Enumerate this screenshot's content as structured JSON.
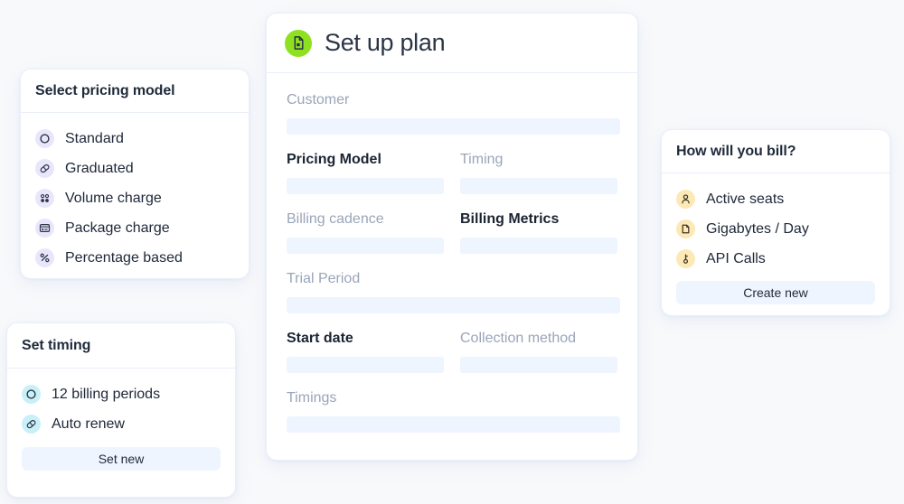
{
  "page": {
    "background_color": "#F8F9FB"
  },
  "pricing_card": {
    "title": "Select pricing model",
    "badge_color": "#E9E6FB",
    "options": [
      {
        "label": "Standard",
        "icon": "circle-outline-icon"
      },
      {
        "label": "Graduated",
        "icon": "pill-tilted-icon"
      },
      {
        "label": "Volume charge",
        "icon": "four-dots-icon"
      },
      {
        "label": "Package charge",
        "icon": "package-box-icon"
      },
      {
        "label": "Percentage based",
        "icon": "percent-icon"
      }
    ]
  },
  "timing_card": {
    "title": "Set timing",
    "badge_color": "#C9F0F8",
    "options": [
      {
        "label": "12 billing periods",
        "icon": "circle-outline-icon"
      },
      {
        "label": "Auto renew",
        "icon": "pill-tilted-icon"
      }
    ],
    "button_label": "Set new"
  },
  "plan_card": {
    "title": "Set up plan",
    "icon": "document-icon",
    "icon_badge_color": "#90E022",
    "fields": [
      {
        "label": "Customer",
        "emphasis": "muted",
        "value": "",
        "width": "full"
      },
      {
        "label": "Pricing Model",
        "emphasis": "strong",
        "value": "",
        "width": "half"
      },
      {
        "label": "Timing",
        "emphasis": "muted",
        "value": "",
        "width": "half"
      },
      {
        "label": "Billing cadence",
        "emphasis": "muted",
        "value": "",
        "width": "half"
      },
      {
        "label": "Billing Metrics",
        "emphasis": "strong",
        "value": "",
        "width": "half"
      },
      {
        "label": "Trial Period",
        "emphasis": "muted",
        "value": "",
        "width": "full"
      },
      {
        "label": "Start date",
        "emphasis": "strong",
        "value": "",
        "width": "half"
      },
      {
        "label": "Collection method",
        "emphasis": "muted",
        "value": "",
        "width": "half"
      },
      {
        "label": "Timings",
        "emphasis": "muted",
        "value": "",
        "width": "full"
      }
    ],
    "input_background": "#EFF5FE"
  },
  "bill_card": {
    "title": "How will you bill?",
    "badge_color": "#FCE9B6",
    "options": [
      {
        "label": "Active seats",
        "icon": "person-icon"
      },
      {
        "label": "Gigabytes / Day",
        "icon": "file-box-icon"
      },
      {
        "label": "API Calls",
        "icon": "key-icon"
      }
    ],
    "button_label": "Create new"
  }
}
